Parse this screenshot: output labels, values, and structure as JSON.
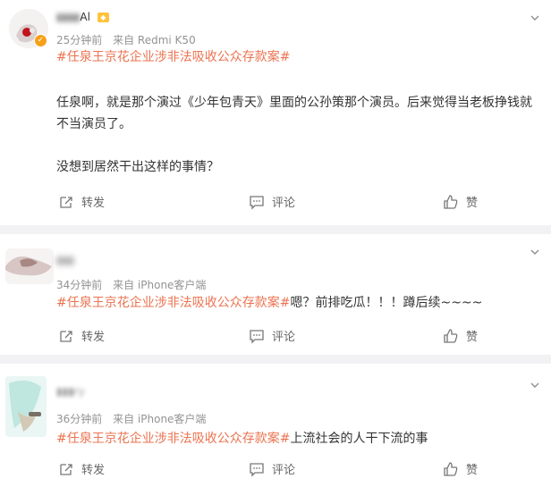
{
  "comments": [
    {
      "user": "Al",
      "time": "25分钟前",
      "source": "来自 Redmi K50",
      "tag": "#任泉王京花企业涉非法吸收公众存款案#",
      "paragraphs": [
        "任泉啊，就是那个演过《少年包青天》里面的公孙策那个演员。后来觉得当老板挣钱就不当演员了。",
        "没想到居然干出这样的事情？"
      ],
      "actions": {
        "repost": "转发",
        "comment": "评论",
        "like": "赞"
      }
    },
    {
      "user": "",
      "time": "34分钟前",
      "source": "来自 iPhone客户端",
      "tag": "#任泉王京花企业涉非法吸收公众存款案#",
      "text": "嗯？前排吃瓜！！！蹲后续~~~~",
      "actions": {
        "repost": "转发",
        "comment": "评论",
        "like": "赞"
      }
    },
    {
      "user": "",
      "time": "36分钟前",
      "source": "来自 iPhone客户端",
      "tag": "#任泉王京花企业涉非法吸收公众存款案#",
      "text": "上流社会的人干下流的事",
      "actions": {
        "repost": "转发",
        "comment": "评论",
        "like": "赞"
      }
    }
  ],
  "colors": {
    "tag": "#eb7350",
    "meta": "#939393",
    "separator": "#f2f2f5"
  },
  "icons": {
    "more": "chevron-down-icon",
    "repost": "repost-icon",
    "comment": "comment-icon",
    "like": "thumbs-up-icon"
  }
}
